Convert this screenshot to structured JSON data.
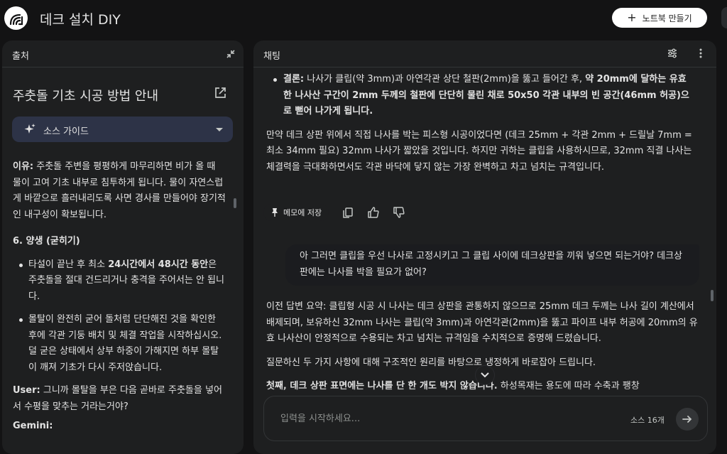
{
  "header": {
    "app_title": "데크 설치 DIY",
    "new_notebook_label": "노트북 만들기"
  },
  "sources_panel": {
    "title": "출처",
    "source_title": "주춧돌 기초 시공 방법 안내",
    "source_guide_label": "소스 가이드",
    "content": {
      "reason_label": "이유:",
      "reason_text": " 주춧돌 주변을 평평하게 마무리하면 비가 올 때 물이 고여 기초 내부로 침투하게 됩니다. 물이 자연스럽게 바깥으로 흘러내리도록 사면 경사를 만들어야 장기적인 내구성이 확보됩니다.",
      "section_heading": "6. 양생 (굳히기)",
      "bullet1_pre": "타설이 끝난 후 최소 ",
      "bullet1_bold": "24시간에서 48시간 동안",
      "bullet1_post": "은 주춧돌을 절대 건드리거나 충격을 주어서는 안 됩니다.",
      "bullet2": "몰탈이 완전히 굳어 돌처럼 단단해진 것을 확인한 후에 각관 기둥 배치 및 체결 작업을 시작하십시오. 덜 굳은 상태에서 상부 하중이 가해지면 하부 몰탈이 깨져 기초가 다시 주저앉습니다.",
      "user_label": "User:",
      "user_text": " 그니까 몰탈을 부은 다음 곧바로 주춧돌을 넣어서 수평을 맞추는 거라는거야?",
      "gemini_label": "Gemini:"
    }
  },
  "chat_panel": {
    "title": "채팅",
    "bullet": {
      "label": "결론:",
      "text": " 나사가 클립(약 3mm)과 아연각관 상단 철판(2mm)을 뚫고 들어간 후, ",
      "bold_text": "약 20mm에 달하는 유효한 나사산 구간이 2mm 두께의 철판에 단단히 물린 채로 50x50 각관 내부의 빈 공간(46mm 허공)으로 뻗어 나가게 됩니다."
    },
    "paragraph": "만약 데크 상판 위에서 직접 나사를 박는 피스형 시공이었다면 (데크 25mm + 각관 2mm + 드릴날 7mm = 최소 34mm 필요) 32mm 나사가 짧았을 것입니다. 하지만 귀하는 클립을 사용하시므로, 32mm 직결 나사는 체결력을 극대화하면서도 각관 바닥에 닿지 않는 가장 완벽하고 차고 넘치는 규격입니다.",
    "save_note_label": "메모에 저장",
    "user_message": "아 그러면 클립을 우선 나사로 고정시키고 그 클립 사이에 데크상판을 끼워 넣으면 되는거야? 데크상판에는 나사를 박을 필요가 없어?",
    "answer_summary": "이전 답변 요약: 클립형 시공 시 나사는 데크 상판을 관통하지 않으므로 25mm 데크 두께는 나사 길이 계산에서 배제되며, 보유하신 32mm 나사는 클립(약 3mm)과 아연각관(2mm)을 뚫고 파이프 내부 허공에 20mm의 유효 나사산이 안정적으로 수용되는 차고 넘치는 규격임을 수치적으로 증명해 드렸습니다.",
    "answer_intro": "질문하신 두 가지 사항에 대해 구조적인 원리를 바탕으로 냉정하게 바로잡아 드립니다.",
    "answer_cut_bold": "첫째, 데크 상판 표면에는 나사를 단 한 개도 박지 않습니다.",
    "answer_cut_rest": " 하성목재는 용도에 따라 수축과 팽창",
    "input_placeholder": "입력을 시작하세요...",
    "source_count": "소스 16개"
  }
}
